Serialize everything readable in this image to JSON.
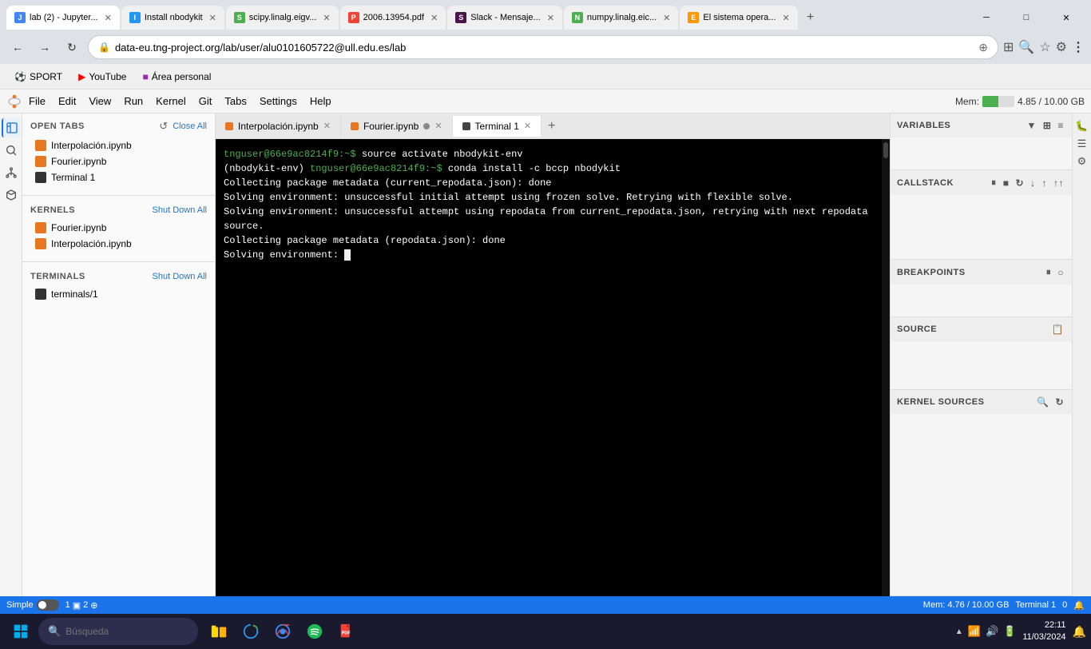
{
  "browser": {
    "tabs": [
      {
        "id": "tab1",
        "title": "lab (2) - Jupyter...",
        "active": true,
        "icon_color": "#4285f4",
        "icon_char": "J"
      },
      {
        "id": "tab2",
        "title": "Install nbodykit",
        "active": false,
        "icon_color": "#2196f3",
        "icon_char": "I"
      },
      {
        "id": "tab3",
        "title": "scipy.linalg.eigv...",
        "active": false,
        "icon_color": "#4caf50",
        "icon_char": "S"
      },
      {
        "id": "tab4",
        "title": "2006.13954.pdf",
        "active": false,
        "icon_color": "#f44336",
        "icon_char": "P"
      },
      {
        "id": "tab5",
        "title": "Slack - Mensaje...",
        "active": false,
        "icon_color": "#4a154b",
        "icon_char": "S"
      },
      {
        "id": "tab6",
        "title": "numpy.linalg.eic...",
        "active": false,
        "icon_color": "#4caf50",
        "icon_char": "N"
      },
      {
        "id": "tab7",
        "title": "El sistema opera...",
        "active": false,
        "icon_color": "#ff9800",
        "icon_char": "E"
      }
    ],
    "address": "data-eu.tng-project.org/lab/user/alu0101605722@ull.edu.es/lab",
    "bookmarks": [
      {
        "label": "SPORT",
        "icon_color": "#555"
      },
      {
        "label": "YouTube",
        "icon_color": "#ff0000"
      },
      {
        "label": "Área personal",
        "icon_color": "#9c27b0"
      }
    ]
  },
  "menu": {
    "items": [
      "File",
      "Edit",
      "View",
      "Run",
      "Kernel",
      "Git",
      "Tabs",
      "Settings",
      "Help"
    ],
    "mem_label": "Mem:",
    "mem_value": "4.85 / 10.00 GB"
  },
  "sidebar": {
    "open_tabs_title": "OPEN TABS",
    "open_tabs_action": "Close All",
    "refresh_icon": "↺",
    "open_tabs": [
      {
        "name": "Interpolación.ipynb",
        "type": "nb"
      },
      {
        "name": "Fourier.ipynb",
        "type": "nb"
      },
      {
        "name": "Terminal 1",
        "type": "term"
      }
    ],
    "kernels_title": "KERNELS",
    "kernels_action": "Shut Down All",
    "kernels": [
      {
        "name": "Fourier.ipynb",
        "type": "nb"
      },
      {
        "name": "Interpolación.ipynb",
        "type": "nb"
      }
    ],
    "terminals_title": "TERMINALS",
    "terminals_action": "Shut Down All",
    "terminals": [
      {
        "name": "terminals/1",
        "type": "term"
      }
    ]
  },
  "nb_tabs": [
    {
      "id": "interp",
      "label": "Interpolación.ipynb",
      "active": false,
      "has_dot": false
    },
    {
      "id": "fourier",
      "label": "Fourier.ipynb",
      "active": false,
      "has_dot": true
    },
    {
      "id": "terminal1",
      "label": "Terminal 1",
      "active": true,
      "has_dot": false
    }
  ],
  "terminal": {
    "lines": [
      {
        "type": "prompt_cmd",
        "prompt": "tnguser@66e9ac8214f9:~$",
        "cmd": " source activate nbodykit-env"
      },
      {
        "type": "prompt_cmd2",
        "prefix": "(nbodykit-env) ",
        "prompt": "tnguser@66e9ac8214f9:~$",
        "cmd": " conda install -c bccp nbodykit"
      },
      {
        "type": "plain",
        "text": "Collecting package metadata (current_repodata.json): done"
      },
      {
        "type": "plain",
        "text": "Solving environment: unsuccessful initial attempt using frozen solve. Retrying with flexible solve."
      },
      {
        "type": "plain",
        "text": "Solving environment: unsuccessful attempt using repodata from current_repodata.json, retrying with next repodata source."
      },
      {
        "type": "plain",
        "text": "Collecting package metadata (repodata.json): done"
      },
      {
        "type": "cursor",
        "text": "Solving environment: "
      }
    ]
  },
  "right_panel": {
    "variables_title": "VARIABLES",
    "callstack_title": "CALLSTACK",
    "breakpoints_title": "BREAKPOINTS",
    "source_title": "SOURCE",
    "kernel_sources_title": "KERNEL SOURCES"
  },
  "status_bar": {
    "mode": "Simple",
    "cell_num": "1",
    "cell_icon": "▣",
    "kernel_num": "2",
    "kernel_icon": "⊕",
    "mem_label": "Mem: 4.76 / 10.00 GB",
    "terminal_label": "Terminal 1",
    "notification_count": "0"
  },
  "taskbar": {
    "search_placeholder": "Búsqueda",
    "clock_time": "22:11",
    "clock_date": "11/03/2024",
    "apps": [
      "📁",
      "🌐",
      "🎵",
      "📄"
    ]
  }
}
